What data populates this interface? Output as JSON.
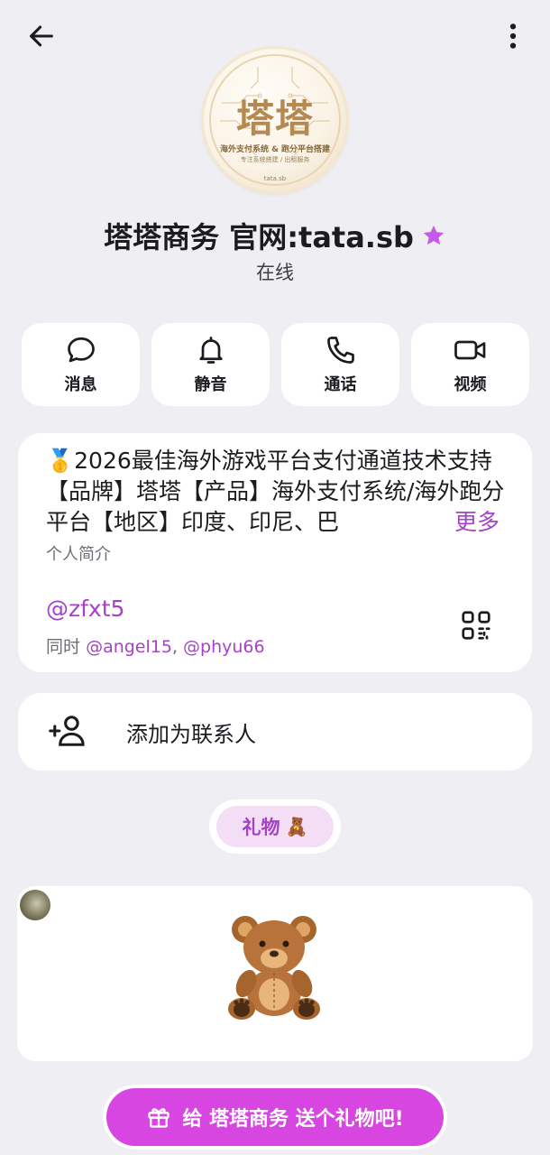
{
  "header": {
    "back_icon": "arrow-left-icon",
    "menu_icon": "more-vertical-icon"
  },
  "avatar": {
    "title": "塔塔",
    "line1": "海外支付系统 & 跑分平台搭建",
    "line2": "专注系统搭建 / 出租服务",
    "line3": "tata.sb"
  },
  "profile": {
    "name": "塔塔商务 官网:tata.sb",
    "badge_icon": "star-icon",
    "status": "在线"
  },
  "actions": [
    {
      "label": "消息",
      "icon": "chat-bubble-icon"
    },
    {
      "label": "静音",
      "icon": "bell-icon"
    },
    {
      "label": "通话",
      "icon": "phone-icon"
    },
    {
      "label": "视频",
      "icon": "video-camera-icon"
    }
  ],
  "bio": {
    "text": "🥇2026最佳海外游戏平台支付通道技术支持【品牌】塔塔【产品】海外支付系统/海外跑分平台【地区】印度、印尼、巴",
    "more_label": "更多",
    "label": "个人简介"
  },
  "username": {
    "handle": "@zfxt5",
    "also_prefix": "同时",
    "also_1": "@angel15",
    "separator": ",",
    "also_2": "@phyu66",
    "qr_icon": "qr-code-icon"
  },
  "contact": {
    "icon": "add-person-icon",
    "label": "添加为联系人"
  },
  "gifts": {
    "chip_label": "礼物",
    "chip_emoji": "🧸",
    "gift_emoji": "🧸"
  },
  "send_gift": {
    "icon": "gift-icon",
    "label": "给 塔塔商务 送个礼物吧!"
  },
  "colors": {
    "accent": "#a641c9",
    "button": "#d746e0",
    "background": "#efeff3"
  }
}
